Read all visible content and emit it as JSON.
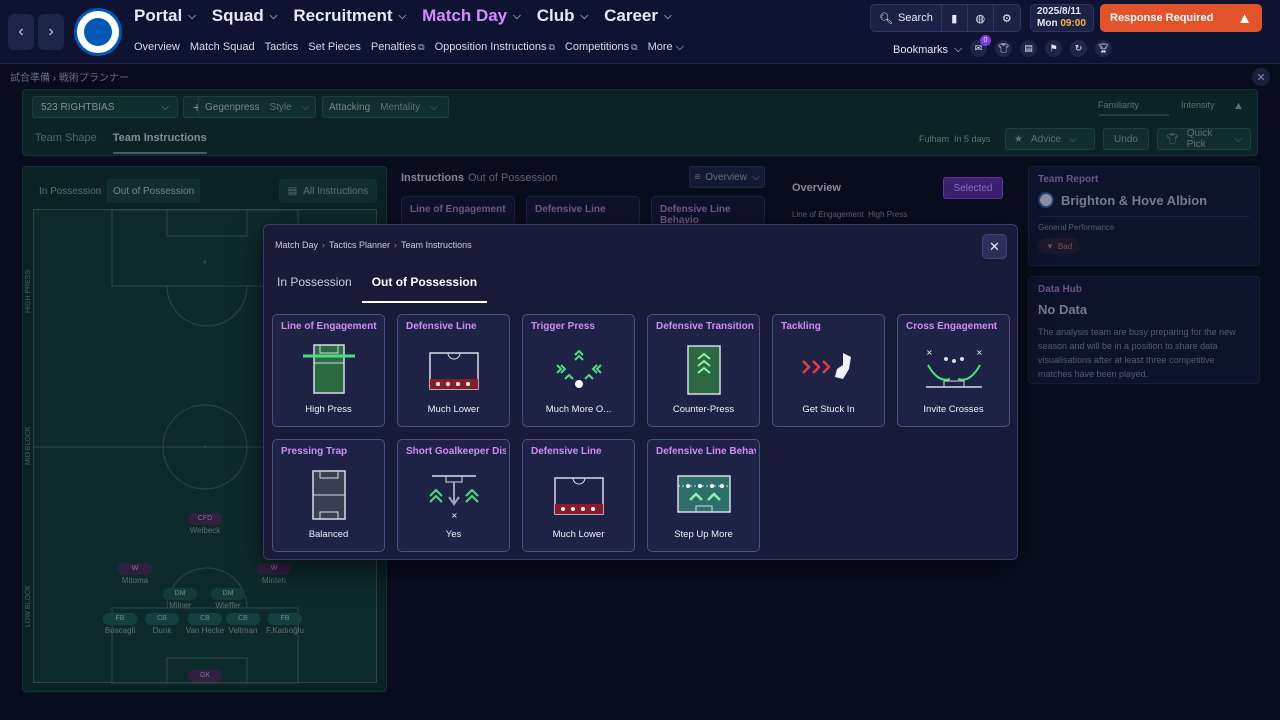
{
  "nav": {
    "items": [
      {
        "label": "Portal",
        "active": false
      },
      {
        "label": "Squad",
        "active": false
      },
      {
        "label": "Recruitment",
        "active": false
      },
      {
        "label": "Match Day",
        "active": true
      },
      {
        "label": "Club",
        "active": false
      },
      {
        "label": "Career",
        "active": false
      }
    ],
    "sub": [
      "Overview",
      "Match Squad",
      "Tactics",
      "Set Pieces",
      "Penalties",
      "Opposition Instructions",
      "Competitions",
      "More"
    ],
    "search_label": "Search",
    "date": "2025/8/11",
    "day": "Mon",
    "time": "09:00",
    "response_label": "Response Required",
    "bookmarks_label": "Bookmarks",
    "badge_count": "0"
  },
  "breadcrumb_top": "試合準備 › 戦術プランナー",
  "tactics": {
    "formation": "523 RIGHTBIAS",
    "style": "Gegenpress",
    "style_label": "Style",
    "mentality": "Attacking",
    "mentality_label": "Mentality",
    "familiarity": "Familiarity",
    "intensity": "Intensity",
    "tabs": [
      "Team Shape",
      "Team Instructions"
    ],
    "opponent": "Fulham",
    "opponent_when": "In 5 days",
    "advice": "Advice",
    "undo": "Undo",
    "quick_pick": "Quick Pick"
  },
  "pitch": {
    "tabs": [
      "In Possession",
      "Out of Possession"
    ],
    "all_instructions": "All Instructions",
    "zones": [
      "HIGH PRESS",
      "MID BLOCK",
      "LOW BLOCK"
    ],
    "players": [
      {
        "pos": "CFD",
        "name": "Welbeck"
      },
      {
        "pos": "W",
        "name": "Mitoma"
      },
      {
        "pos": "W",
        "name": "Minteh"
      },
      {
        "pos": "DM",
        "name": "Milner"
      },
      {
        "pos": "DM",
        "name": "Wieffer"
      },
      {
        "pos": "FB",
        "name": "Boscagli"
      },
      {
        "pos": "CB",
        "name": "Dunk"
      },
      {
        "pos": "CB",
        "name": "Van Hecke"
      },
      {
        "pos": "CB",
        "name": "Veltman"
      },
      {
        "pos": "FB",
        "name": "F.Kadıoğlu"
      },
      {
        "pos": "GK",
        "name": ""
      }
    ]
  },
  "instructions_bg": {
    "title": "Instructions",
    "subtitle": "Out of Possession",
    "dropdown": "Overview",
    "cards": [
      "Line of Engagement",
      "Defensive Line",
      "Defensive Line Behavio"
    ]
  },
  "overview_bg": {
    "title": "Overview",
    "selected": "Selected",
    "line": "Line of Engagement",
    "line_value": "High Press"
  },
  "team_report": {
    "head": "Team Report",
    "team": "Brighton & Hove Albion",
    "general": "General Performance",
    "rating": "Bad"
  },
  "data_hub": {
    "head": "Data Hub",
    "title": "No Data",
    "text": "The analysis team are busy preparing for the new season and will be in a position to share data visualisations after at least three competitive matches have been played."
  },
  "modal": {
    "breadcrumb": [
      "Match Day",
      "Tactics Planner",
      "Team Instructions"
    ],
    "tabs": [
      "In Possession",
      "Out of Possession"
    ],
    "active_tab": "Out of Possession",
    "cards": [
      {
        "title": "Line of Engagement",
        "value": "High Press",
        "icon": "pitch-high-press-icon"
      },
      {
        "title": "Defensive Line",
        "value": "Much Lower",
        "icon": "defensive-line-icon"
      },
      {
        "title": "Trigger Press",
        "value": "Much More O...",
        "icon": "trigger-press-icon"
      },
      {
        "title": "Defensive Transition",
        "value": "Counter-Press",
        "icon": "counter-press-icon"
      },
      {
        "title": "Tackling",
        "value": "Get Stuck In",
        "icon": "tackling-boot-icon"
      },
      {
        "title": "Cross Engagement",
        "value": "Invite Crosses",
        "icon": "cross-engagement-icon"
      },
      {
        "title": "Pressing Trap",
        "value": "Balanced",
        "icon": "pressing-trap-icon"
      },
      {
        "title": "Short Goalkeeper Distr",
        "value": "Yes",
        "icon": "goalkeeper-distribution-icon"
      },
      {
        "title": "Defensive Line",
        "value": "Much Lower",
        "icon": "defensive-line-icon"
      },
      {
        "title": "Defensive Line Behavio",
        "value": "Step Up More",
        "icon": "step-up-icon"
      }
    ]
  },
  "colors": {
    "accent": "#d68cff",
    "response": "#e2532a",
    "time": "#ffb347",
    "pitch_bg": "#133d37"
  }
}
